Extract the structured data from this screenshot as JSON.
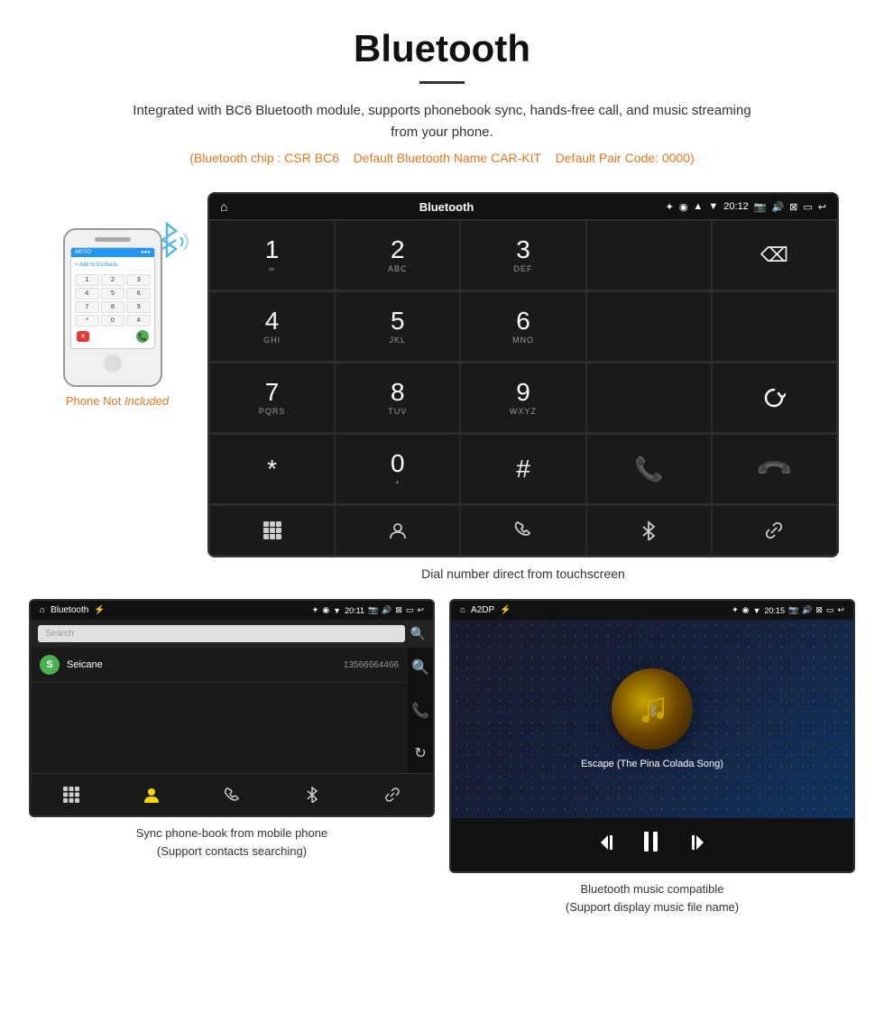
{
  "page": {
    "title": "Bluetooth",
    "description": "Integrated with BC6 Bluetooth module, supports phonebook sync, hands-free call, and music streaming from your phone.",
    "specs_chip": "Bluetooth chip : CSR BC6",
    "specs_name": "Default Bluetooth Name CAR-KIT",
    "specs_code": "Default Pair Code: 0000",
    "dial_caption": "Dial number direct from touchscreen"
  },
  "phone": {
    "not_included": "Phone Not Included",
    "not": "Phone Not",
    "included": "Included"
  },
  "dial_screen": {
    "title": "Bluetooth",
    "time": "20:12",
    "keys": [
      {
        "num": "1",
        "sub": ""
      },
      {
        "num": "2",
        "sub": "ABC"
      },
      {
        "num": "3",
        "sub": "DEF"
      },
      {
        "num": "4",
        "sub": "GHI"
      },
      {
        "num": "5",
        "sub": "JKL"
      },
      {
        "num": "6",
        "sub": "MNO"
      },
      {
        "num": "7",
        "sub": "PQRS"
      },
      {
        "num": "8",
        "sub": "TUV"
      },
      {
        "num": "9",
        "sub": "WXYZ"
      },
      {
        "num": "*",
        "sub": ""
      },
      {
        "num": "0",
        "sub": "+"
      },
      {
        "num": "#",
        "sub": ""
      }
    ]
  },
  "phonebook_screen": {
    "title": "Bluetooth",
    "time": "20:11",
    "search_placeholder": "Search",
    "contacts": [
      {
        "letter": "S",
        "name": "Seicane",
        "number": "13566664466"
      }
    ],
    "caption": "Sync phone-book from mobile phone\n(Support contacts searching)"
  },
  "music_screen": {
    "title": "A2DP",
    "time": "20:15",
    "song_title": "Escape (The Pina Colada Song)",
    "caption": "Bluetooth music compatible\n(Support display music file name)"
  }
}
